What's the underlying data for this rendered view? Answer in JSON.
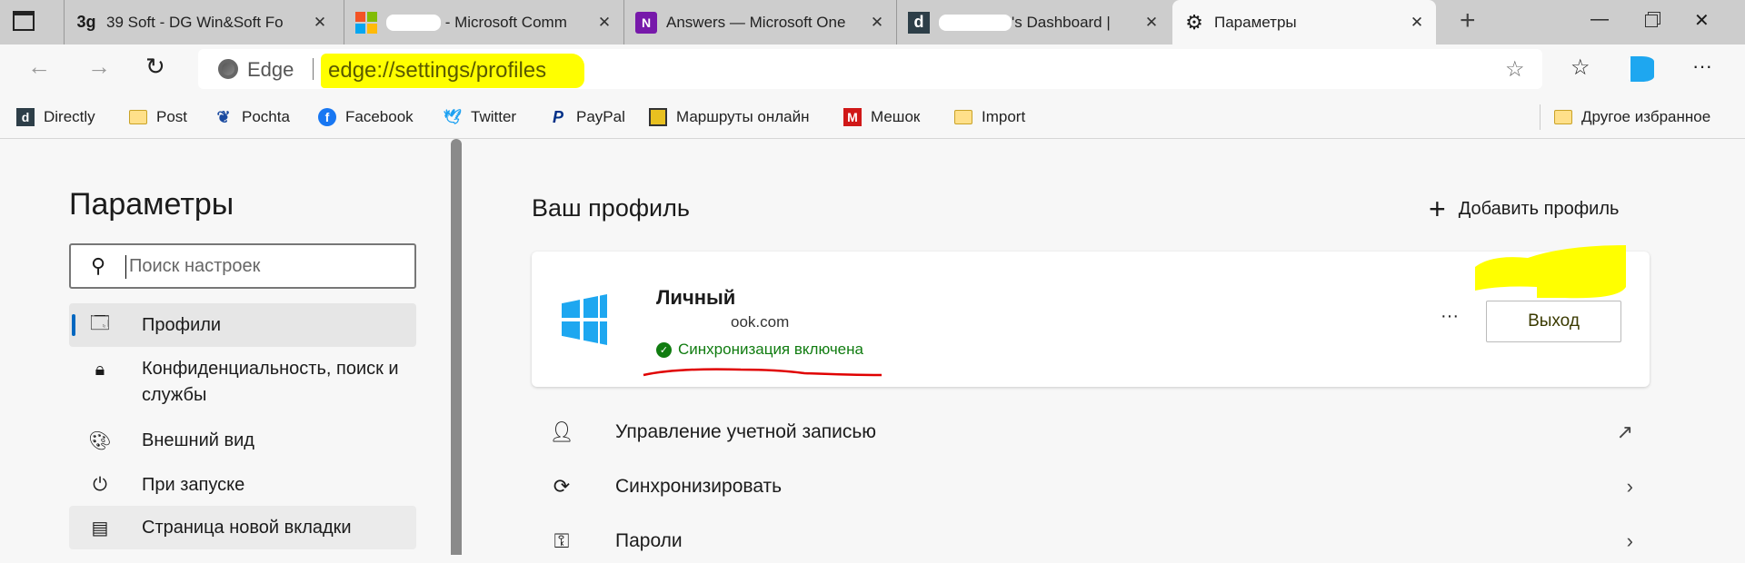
{
  "tabs": [
    {
      "icon": "39-soft-icon",
      "glyph": "3g",
      "title": "39 Soft - DG Win&Soft Fo"
    },
    {
      "icon": "microsoft-icon",
      "glyph": "",
      "title": "- Microsoft Comm"
    },
    {
      "icon": "onenote-icon",
      "glyph": "N",
      "title": "Answers — Microsoft One"
    },
    {
      "icon": "directly-icon",
      "glyph": "d",
      "title": "'s Dashboard | "
    },
    {
      "icon": "gear-icon",
      "glyph": "⚙",
      "title": "Параметры",
      "active": true
    }
  ],
  "address": {
    "site_label": "Edge",
    "url": "edge://settings/profiles"
  },
  "bookmarks": [
    {
      "icon": "directly-icon",
      "label": "Directly"
    },
    {
      "icon": "folder-icon",
      "label": "Post"
    },
    {
      "icon": "pochta-icon",
      "label": "Pochta"
    },
    {
      "icon": "facebook-icon",
      "label": "Facebook"
    },
    {
      "icon": "twitter-icon",
      "label": "Twitter"
    },
    {
      "icon": "paypal-icon",
      "label": "PayPal"
    },
    {
      "icon": "bus-icon",
      "label": "Маршруты онлайн"
    },
    {
      "icon": "meshok-icon",
      "label": "Мешок"
    },
    {
      "icon": "folder-icon",
      "label": "Import"
    }
  ],
  "other_favorites": "Другое избранное",
  "sidebar": {
    "title": "Параметры",
    "search_placeholder": "Поиск настроек",
    "items": [
      {
        "icon": "profile-icon",
        "label": "Профили",
        "selected": true
      },
      {
        "icon": "lock-icon",
        "label": "Конфиденциальность, поиск и",
        "label2": "службы"
      },
      {
        "icon": "palette-icon",
        "label": "Внешний вид"
      },
      {
        "icon": "power-icon",
        "label": "При запуске"
      },
      {
        "icon": "new-tab-icon",
        "label": "Страница новой вкладки",
        "hover": true
      }
    ]
  },
  "main": {
    "title": "Ваш профиль",
    "add_profile": "Добавить профиль",
    "profile": {
      "name": "Личный",
      "email": "ook.com",
      "sync_status": "Синхронизация включена",
      "signout": "Выход"
    },
    "rows": [
      {
        "icon": "person-icon",
        "label": "Управление учетной записью",
        "right": "external-link-icon"
      },
      {
        "icon": "sync-icon",
        "label": "Синхронизировать",
        "right": "chevron-right-icon"
      },
      {
        "icon": "key-icon",
        "label": "Пароли",
        "right": "chevron-right-icon"
      }
    ]
  },
  "colors": {
    "accent": "#0067c0",
    "sync_green": "#107c10",
    "highlight": "#ffff00",
    "annotation_red": "#e00000"
  }
}
